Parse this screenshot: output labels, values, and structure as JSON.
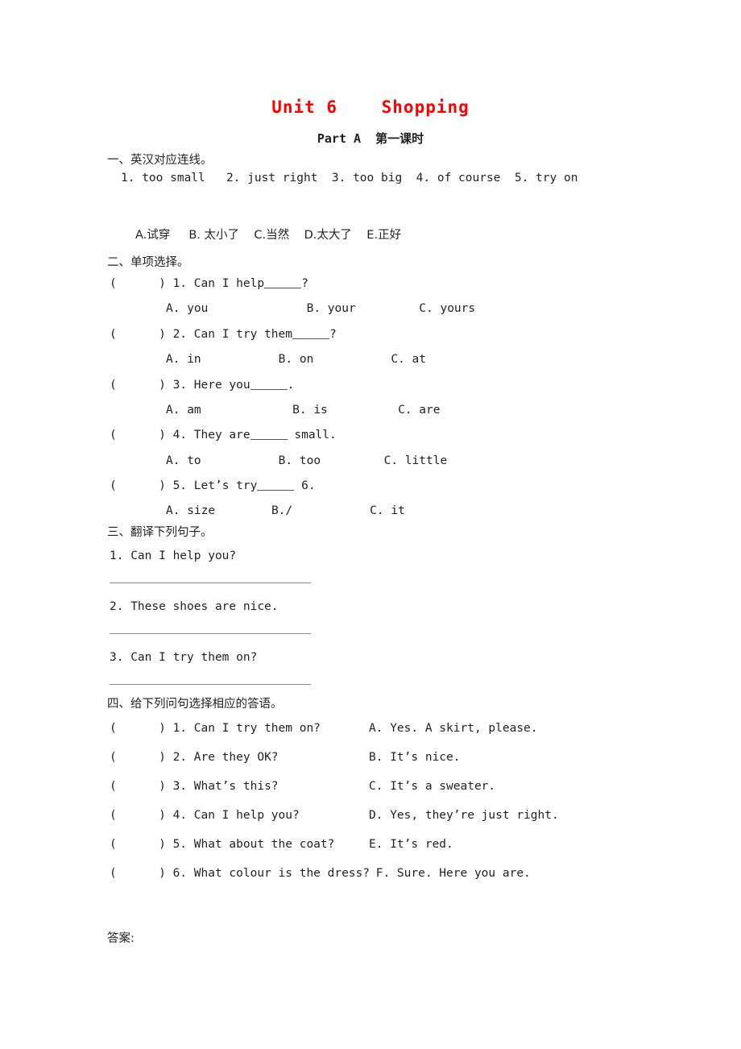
{
  "document": {
    "title": "Unit 6    Shopping",
    "subtitle": "Part A  第一课时"
  },
  "section1": {
    "heading": "一、英汉对应连线。",
    "english_items": "1. too small   2. just right  3. too big  4. of course  5. try on",
    "chinese_items": "A.试穿     B. 太小了    C.当然    D.太大了    E.正好"
  },
  "section2": {
    "heading": "二、单项选择。",
    "questions": [
      {
        "bracket": "(      )",
        "number": "1.",
        "stem_before": "Can I help",
        "stem_after": "?",
        "options": "A. you              B. your         C. yours"
      },
      {
        "bracket": "(      )",
        "number": "2.",
        "stem_before": "Can I try them",
        "stem_after": "?",
        "options": "A. in           B. on           C. at"
      },
      {
        "bracket": "(      )",
        "number": "3.",
        "stem_before": "Here you",
        "stem_after": ".",
        "options": "A. am             B. is          C. are"
      },
      {
        "bracket": "(      )",
        "number": "4.",
        "stem_before": "They are",
        "stem_after": " small.",
        "options": "A. to           B. too         C. little"
      },
      {
        "bracket": "(      )",
        "number": "5.",
        "stem_before": "Let’s try",
        "stem_after": " 6.",
        "options": "A. size        B./           C. it"
      }
    ]
  },
  "section3": {
    "heading": "三、翻译下列句子。",
    "sentences": [
      "1. Can I help you?",
      "2. These shoes are nice.",
      "3. Can I try them on?"
    ]
  },
  "section4": {
    "heading": "四、给下列问句选择相应的答语。",
    "rows": [
      {
        "bracket": "(      )",
        "question": "1. Can I try them on?",
        "answer": "A. Yes. A skirt, please."
      },
      {
        "bracket": "(      )",
        "question": "2. Are they OK?",
        "answer": "B. It’s nice."
      },
      {
        "bracket": "(      )",
        "question": "3. What’s this?",
        "answer": "C. It’s a sweater."
      },
      {
        "bracket": "(      )",
        "question": "4. Can I help you?",
        "answer": "D. Yes, they’re just right."
      },
      {
        "bracket": "(      )",
        "question": "5. What about the coat?",
        "answer": "E. It’s red."
      },
      {
        "bracket": "(      )",
        "question": "6. What colour is the dress?",
        "answer": " F. Sure. Here you are."
      }
    ]
  },
  "footer": {
    "answers_label": "答案:"
  },
  "colors": {
    "title_red": "#ff0000",
    "body_text": "#231f20",
    "rule_gray": "#8a8a8a"
  }
}
